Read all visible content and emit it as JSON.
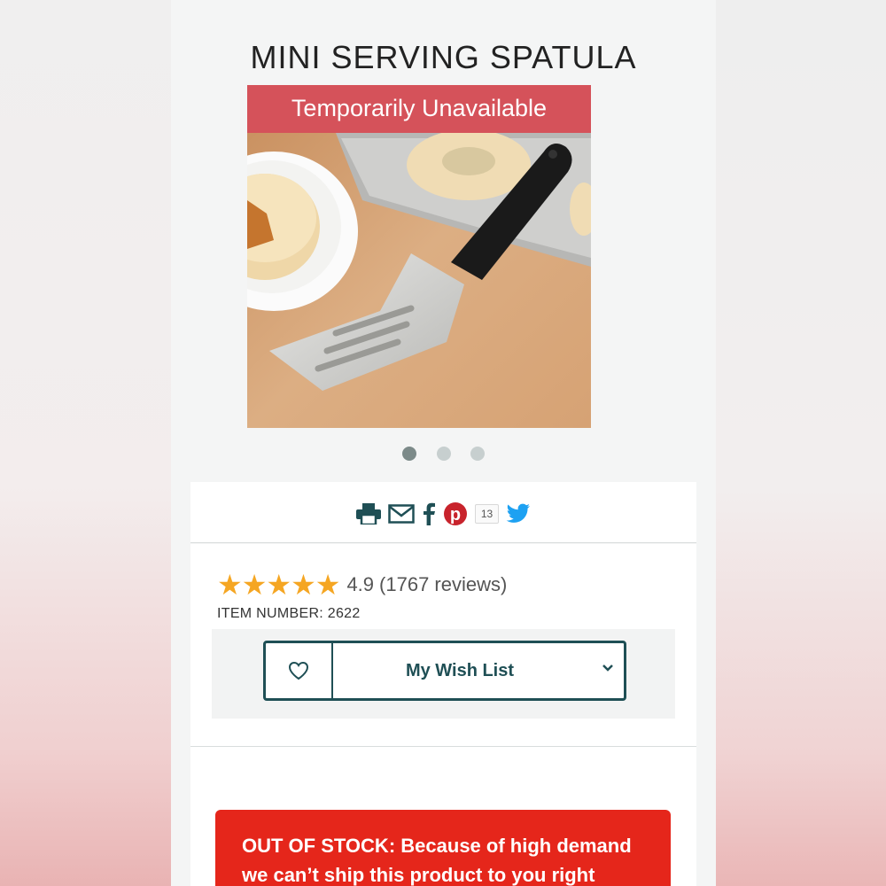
{
  "product": {
    "title": "MINI SERVING SPATULA",
    "availability_banner": "Temporarily Unavailable",
    "image_alt": "Mini serving spatula with black handle on wooden board next to cookies"
  },
  "carousel": {
    "total": 3,
    "active": 1
  },
  "share": {
    "icons": [
      "printer-icon",
      "email-icon",
      "facebook-icon",
      "pinterest-icon",
      "twitter-icon"
    ],
    "pinterest_count": "13"
  },
  "rating": {
    "stars": "★★★★★",
    "score": "4.9",
    "reviews": "(1767 reviews)"
  },
  "item_number": "ITEM NUMBER: 2622",
  "wish_list": {
    "label": "My Wish List"
  },
  "stock_alert": {
    "lead": "OUT OF STOCK:",
    "body": "Because of high demand we can’t ship this product to you right"
  },
  "colors": {
    "accent": "#1f4f55",
    "banner": "#d5525a",
    "alert": "#e5261b",
    "star": "#f5a623",
    "pinterest": "#c8232c",
    "twitter": "#1da1f2",
    "facebook": "#3b5998"
  }
}
